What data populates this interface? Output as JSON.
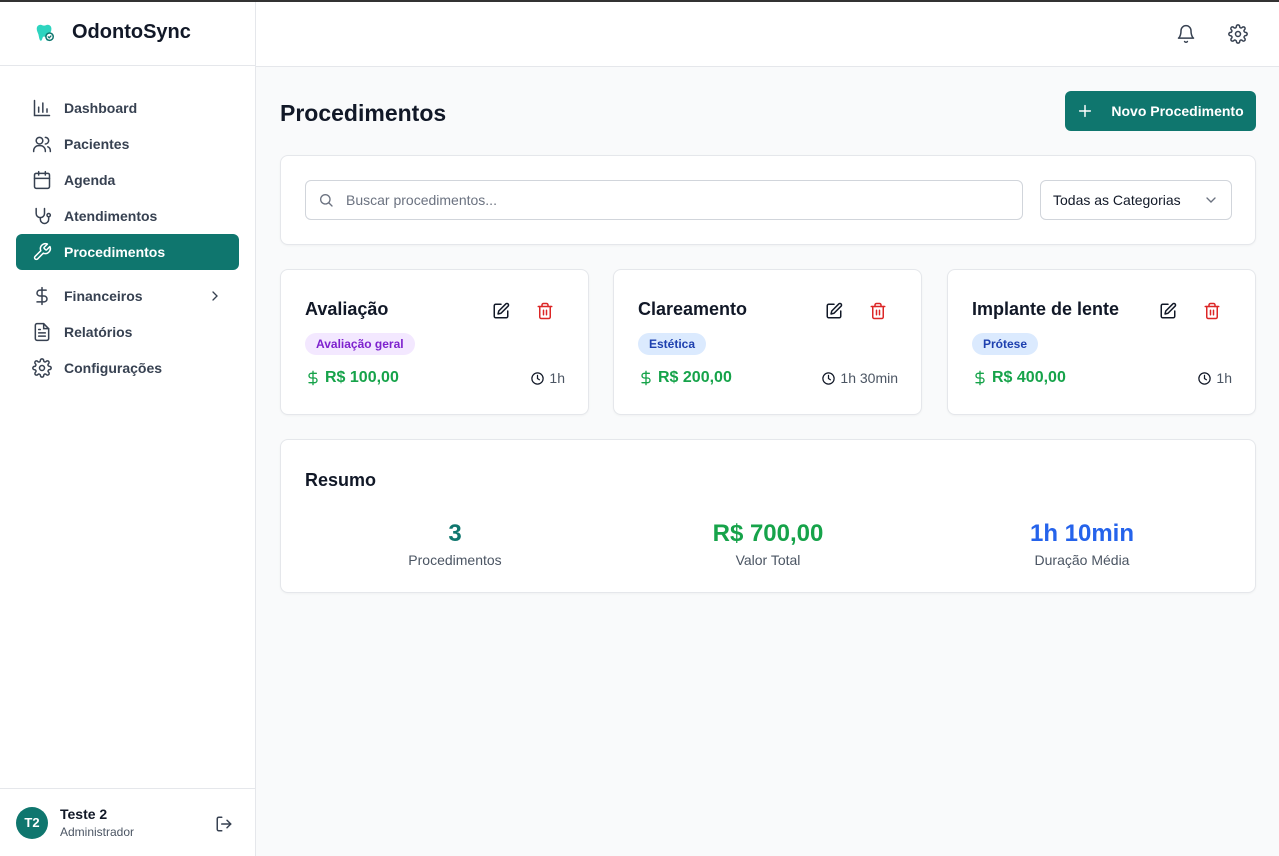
{
  "app": {
    "name": "OdontoSync",
    "accent": "#0f766e"
  },
  "sidebar": {
    "items": [
      {
        "label": "Dashboard",
        "icon": "bar-chart-icon"
      },
      {
        "label": "Pacientes",
        "icon": "users-icon"
      },
      {
        "label": "Agenda",
        "icon": "calendar-icon"
      },
      {
        "label": "Atendimentos",
        "icon": "stethoscope-icon"
      },
      {
        "label": "Procedimentos",
        "icon": "wrench-icon",
        "active": true
      },
      {
        "label": "Financeiros",
        "icon": "dollar-icon",
        "expandable": true
      },
      {
        "label": "Relatórios",
        "icon": "file-text-icon"
      },
      {
        "label": "Configurações",
        "icon": "gear-icon"
      }
    ]
  },
  "user": {
    "initials": "T2",
    "name": "Teste 2",
    "role": "Administrador"
  },
  "header": {
    "icons": [
      "bell-icon",
      "gear-icon"
    ]
  },
  "page": {
    "title": "Procedimentos",
    "new_button": "Novo Procedimento"
  },
  "filters": {
    "search_placeholder": "Buscar procedimentos...",
    "category_selected": "Todas as Categorias"
  },
  "procedures": [
    {
      "name": "Avaliação",
      "category": "Avaliação geral",
      "badge_bg": "#f3e8ff",
      "badge_fg": "#7e22ce",
      "price": "R$ 100,00",
      "duration": "1h"
    },
    {
      "name": "Clareamento",
      "category": "Estética",
      "badge_bg": "#dbeafe",
      "badge_fg": "#1e40af",
      "price": "R$ 200,00",
      "duration": "1h 30min"
    },
    {
      "name": "Implante de lente",
      "category": "Prótese",
      "badge_bg": "#dbeafe",
      "badge_fg": "#1e40af",
      "price": "R$ 400,00",
      "duration": "1h"
    }
  ],
  "summary": {
    "title": "Resumo",
    "stats": [
      {
        "value": "3",
        "label": "Procedimentos",
        "color": "#0f766e"
      },
      {
        "value": "R$ 700,00",
        "label": "Valor Total",
        "color": "#16a34a"
      },
      {
        "value": "1h 10min",
        "label": "Duração Média",
        "color": "#2563eb"
      }
    ]
  }
}
